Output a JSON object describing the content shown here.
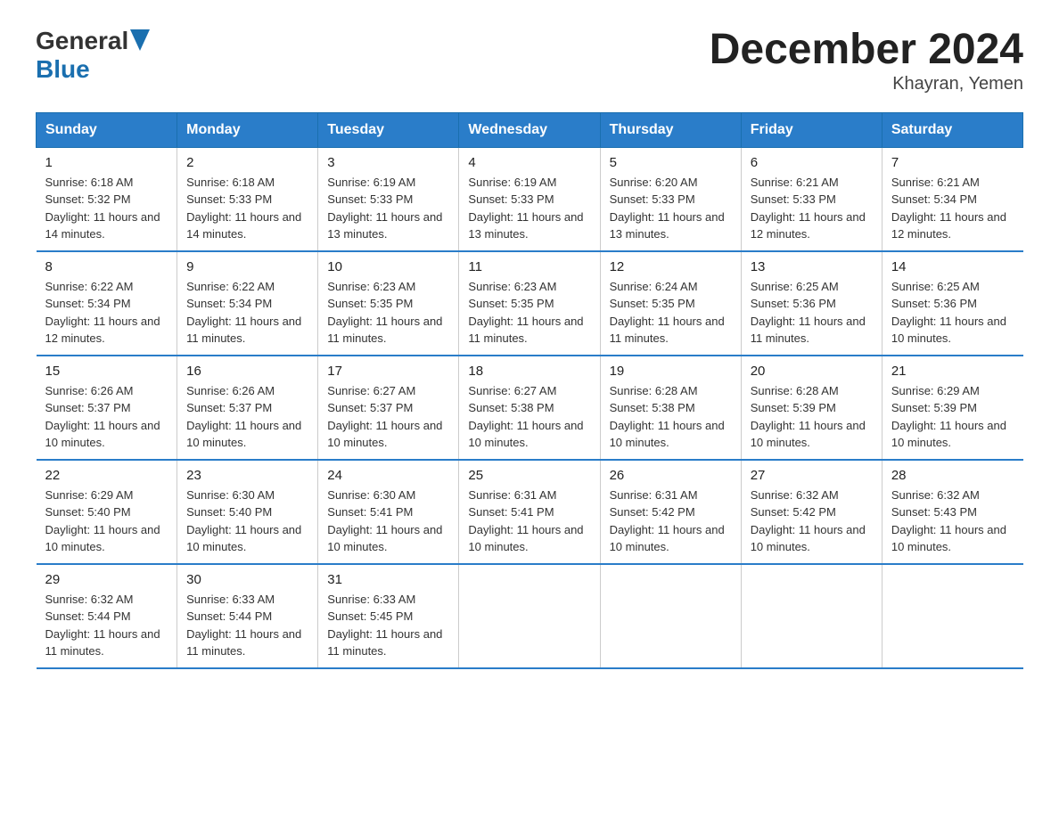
{
  "header": {
    "logo_general": "General",
    "logo_blue": "Blue",
    "month_title": "December 2024",
    "location": "Khayran, Yemen"
  },
  "calendar": {
    "days_of_week": [
      "Sunday",
      "Monday",
      "Tuesday",
      "Wednesday",
      "Thursday",
      "Friday",
      "Saturday"
    ],
    "weeks": [
      [
        {
          "day": "1",
          "sunrise": "6:18 AM",
          "sunset": "5:32 PM",
          "daylight": "11 hours and 14 minutes."
        },
        {
          "day": "2",
          "sunrise": "6:18 AM",
          "sunset": "5:33 PM",
          "daylight": "11 hours and 14 minutes."
        },
        {
          "day": "3",
          "sunrise": "6:19 AM",
          "sunset": "5:33 PM",
          "daylight": "11 hours and 13 minutes."
        },
        {
          "day": "4",
          "sunrise": "6:19 AM",
          "sunset": "5:33 PM",
          "daylight": "11 hours and 13 minutes."
        },
        {
          "day": "5",
          "sunrise": "6:20 AM",
          "sunset": "5:33 PM",
          "daylight": "11 hours and 13 minutes."
        },
        {
          "day": "6",
          "sunrise": "6:21 AM",
          "sunset": "5:33 PM",
          "daylight": "11 hours and 12 minutes."
        },
        {
          "day": "7",
          "sunrise": "6:21 AM",
          "sunset": "5:34 PM",
          "daylight": "11 hours and 12 minutes."
        }
      ],
      [
        {
          "day": "8",
          "sunrise": "6:22 AM",
          "sunset": "5:34 PM",
          "daylight": "11 hours and 12 minutes."
        },
        {
          "day": "9",
          "sunrise": "6:22 AM",
          "sunset": "5:34 PM",
          "daylight": "11 hours and 11 minutes."
        },
        {
          "day": "10",
          "sunrise": "6:23 AM",
          "sunset": "5:35 PM",
          "daylight": "11 hours and 11 minutes."
        },
        {
          "day": "11",
          "sunrise": "6:23 AM",
          "sunset": "5:35 PM",
          "daylight": "11 hours and 11 minutes."
        },
        {
          "day": "12",
          "sunrise": "6:24 AM",
          "sunset": "5:35 PM",
          "daylight": "11 hours and 11 minutes."
        },
        {
          "day": "13",
          "sunrise": "6:25 AM",
          "sunset": "5:36 PM",
          "daylight": "11 hours and 11 minutes."
        },
        {
          "day": "14",
          "sunrise": "6:25 AM",
          "sunset": "5:36 PM",
          "daylight": "11 hours and 10 minutes."
        }
      ],
      [
        {
          "day": "15",
          "sunrise": "6:26 AM",
          "sunset": "5:37 PM",
          "daylight": "11 hours and 10 minutes."
        },
        {
          "day": "16",
          "sunrise": "6:26 AM",
          "sunset": "5:37 PM",
          "daylight": "11 hours and 10 minutes."
        },
        {
          "day": "17",
          "sunrise": "6:27 AM",
          "sunset": "5:37 PM",
          "daylight": "11 hours and 10 minutes."
        },
        {
          "day": "18",
          "sunrise": "6:27 AM",
          "sunset": "5:38 PM",
          "daylight": "11 hours and 10 minutes."
        },
        {
          "day": "19",
          "sunrise": "6:28 AM",
          "sunset": "5:38 PM",
          "daylight": "11 hours and 10 minutes."
        },
        {
          "day": "20",
          "sunrise": "6:28 AM",
          "sunset": "5:39 PM",
          "daylight": "11 hours and 10 minutes."
        },
        {
          "day": "21",
          "sunrise": "6:29 AM",
          "sunset": "5:39 PM",
          "daylight": "11 hours and 10 minutes."
        }
      ],
      [
        {
          "day": "22",
          "sunrise": "6:29 AM",
          "sunset": "5:40 PM",
          "daylight": "11 hours and 10 minutes."
        },
        {
          "day": "23",
          "sunrise": "6:30 AM",
          "sunset": "5:40 PM",
          "daylight": "11 hours and 10 minutes."
        },
        {
          "day": "24",
          "sunrise": "6:30 AM",
          "sunset": "5:41 PM",
          "daylight": "11 hours and 10 minutes."
        },
        {
          "day": "25",
          "sunrise": "6:31 AM",
          "sunset": "5:41 PM",
          "daylight": "11 hours and 10 minutes."
        },
        {
          "day": "26",
          "sunrise": "6:31 AM",
          "sunset": "5:42 PM",
          "daylight": "11 hours and 10 minutes."
        },
        {
          "day": "27",
          "sunrise": "6:32 AM",
          "sunset": "5:42 PM",
          "daylight": "11 hours and 10 minutes."
        },
        {
          "day": "28",
          "sunrise": "6:32 AM",
          "sunset": "5:43 PM",
          "daylight": "11 hours and 10 minutes."
        }
      ],
      [
        {
          "day": "29",
          "sunrise": "6:32 AM",
          "sunset": "5:44 PM",
          "daylight": "11 hours and 11 minutes."
        },
        {
          "day": "30",
          "sunrise": "6:33 AM",
          "sunset": "5:44 PM",
          "daylight": "11 hours and 11 minutes."
        },
        {
          "day": "31",
          "sunrise": "6:33 AM",
          "sunset": "5:45 PM",
          "daylight": "11 hours and 11 minutes."
        },
        null,
        null,
        null,
        null
      ]
    ]
  }
}
